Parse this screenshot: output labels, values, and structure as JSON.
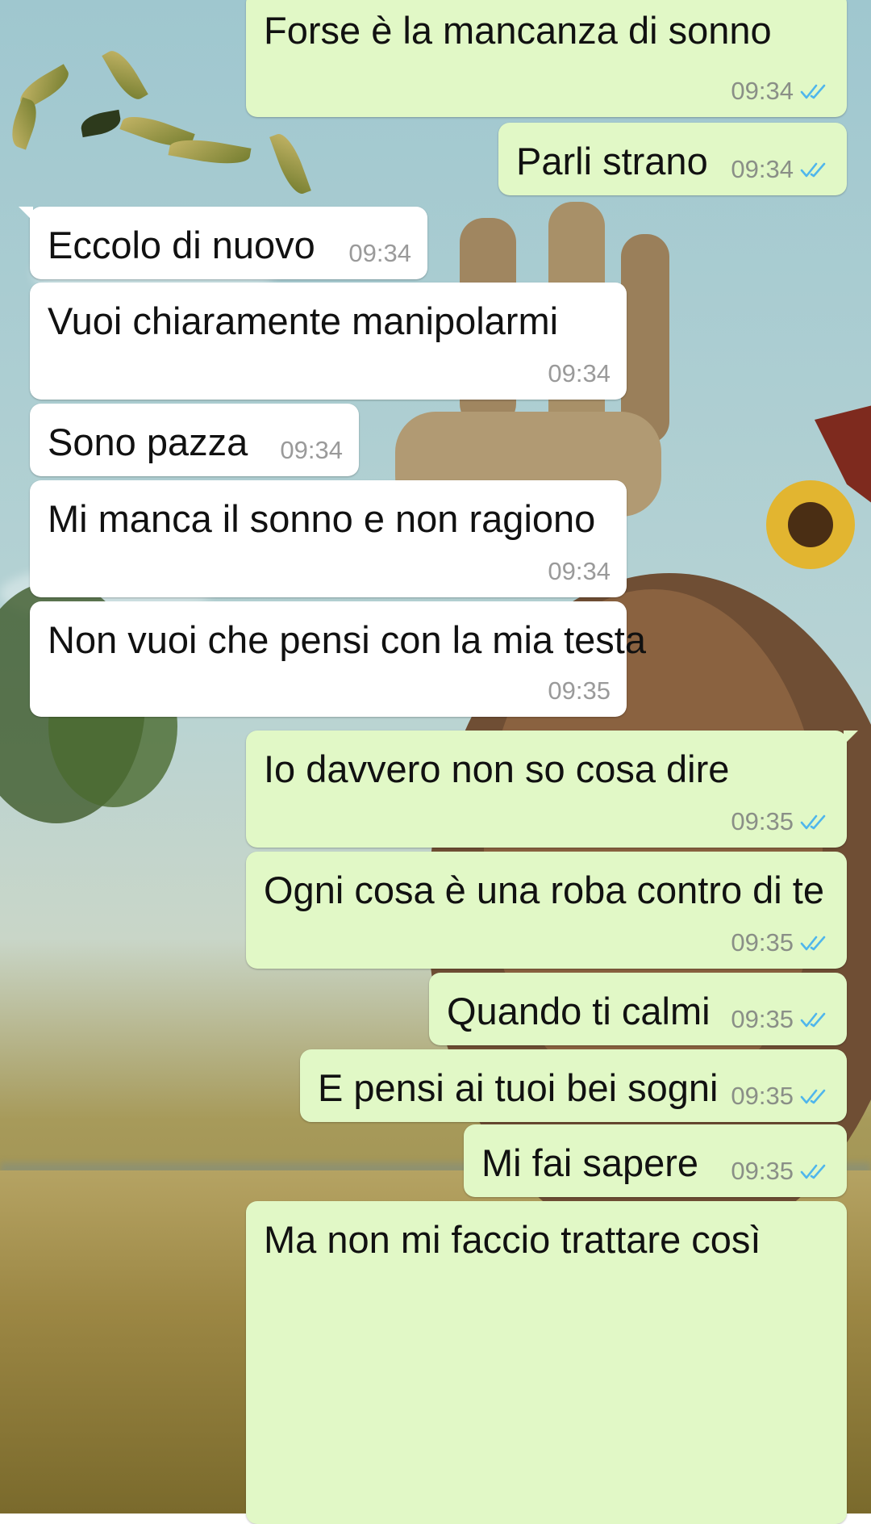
{
  "messages": [
    {
      "dir": "out",
      "text": "Forse è la mancanza di sonno",
      "time": "09:34",
      "read": true
    },
    {
      "dir": "out",
      "text": "Parli strano",
      "time": "09:34",
      "read": true
    },
    {
      "dir": "in",
      "text": "Eccolo di nuovo",
      "time": "09:34"
    },
    {
      "dir": "in",
      "text": "Vuoi chiaramente manipolarmi",
      "time": "09:34"
    },
    {
      "dir": "in",
      "text": "Sono pazza",
      "time": "09:34"
    },
    {
      "dir": "in",
      "text": "Mi manca il sonno e non ragiono",
      "time": "09:34"
    },
    {
      "dir": "in",
      "text": "Non vuoi che pensi con la mia testa",
      "time": "09:35"
    },
    {
      "dir": "out",
      "text": "Io davvero non so cosa dire",
      "time": "09:35",
      "read": true
    },
    {
      "dir": "out",
      "text": "Ogni cosa è una roba contro di te",
      "time": "09:35",
      "read": true
    },
    {
      "dir": "out",
      "text": "Quando ti calmi",
      "time": "09:35",
      "read": true
    },
    {
      "dir": "out",
      "text": "E pensi ai tuoi bei sogni",
      "time": "09:35",
      "read": true
    },
    {
      "dir": "out",
      "text": "Mi fai sapere",
      "time": "09:35",
      "read": true
    },
    {
      "dir": "out",
      "text": "Ma non mi faccio trattare così",
      "time": ""
    }
  ],
  "colors": {
    "outgoing": "#e1f8c6",
    "incoming": "#ffffff",
    "read_ticks": "#4fb6ec"
  }
}
